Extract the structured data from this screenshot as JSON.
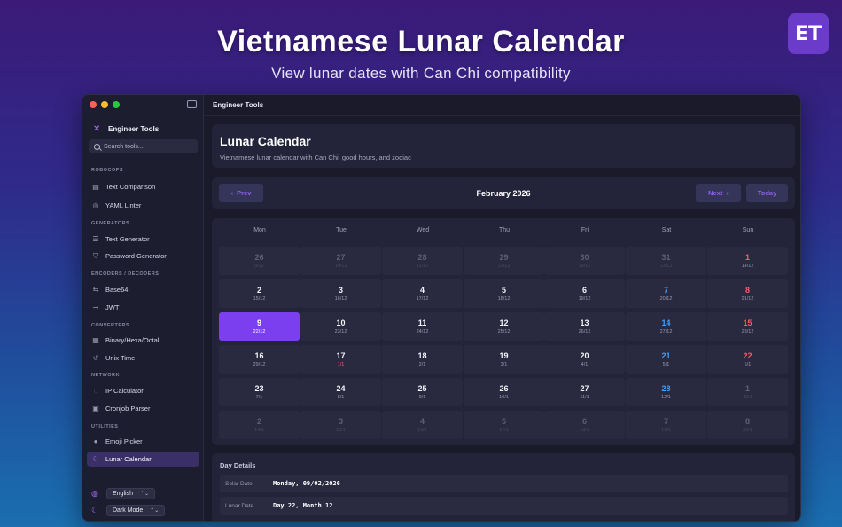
{
  "hero": {
    "title": "Vietnamese Lunar Calendar",
    "subtitle": "View lunar dates with Can Chi compatibility",
    "badge": "ET"
  },
  "sidebar": {
    "app_name": "Engineer Tools",
    "search_placeholder": "Search tools...",
    "sections": [
      {
        "title": "ROBOCOPS",
        "items": [
          {
            "label": "Text Comparison",
            "icon": "compare-icon"
          },
          {
            "label": "YAML Linter",
            "icon": "check-circle-icon"
          }
        ]
      },
      {
        "title": "GENERATORS",
        "items": [
          {
            "label": "Text Generator",
            "icon": "text-lines-icon"
          },
          {
            "label": "Password Generator",
            "icon": "shield-icon"
          }
        ]
      },
      {
        "title": "ENCODERS / DECODERS",
        "items": [
          {
            "label": "Base64",
            "icon": "swap-icon"
          },
          {
            "label": "JWT",
            "icon": "key-icon"
          }
        ]
      },
      {
        "title": "CONVERTERS",
        "items": [
          {
            "label": "Binary/Hexa/Octal",
            "icon": "calculator-icon"
          },
          {
            "label": "Unix Time",
            "icon": "history-icon"
          }
        ]
      },
      {
        "title": "NETWORK",
        "items": [
          {
            "label": "IP Calculator",
            "icon": "network-icon"
          },
          {
            "label": "Cronjob Parser",
            "icon": "calendar-clock-icon"
          }
        ]
      },
      {
        "title": "UTILITIES",
        "items": [
          {
            "label": "Emoji Picker",
            "icon": "emoji-icon"
          },
          {
            "label": "Lunar Calendar",
            "icon": "moon-icon",
            "active": true
          }
        ]
      }
    ],
    "language": "English",
    "theme": "Dark Mode"
  },
  "main": {
    "window_title": "Engineer Tools",
    "page_title": "Lunar Calendar",
    "page_subtitle": "Vietnamese lunar calendar with Can Chi, good hours, and zodiac",
    "prev_label": "Prev",
    "next_label": "Next",
    "today_label": "Today",
    "month_label": "February 2026",
    "weekdays": [
      "Mon",
      "Tue",
      "Wed",
      "Thu",
      "Fri",
      "Sat",
      "Sun"
    ],
    "weeks": [
      [
        {
          "d": "26",
          "l": "9/12",
          "o": true
        },
        {
          "d": "27",
          "l": "10/12",
          "o": true
        },
        {
          "d": "28",
          "l": "11/12",
          "o": true
        },
        {
          "d": "29",
          "l": "12/12",
          "o": true
        },
        {
          "d": "30",
          "l": "13/12",
          "o": true
        },
        {
          "d": "31",
          "l": "13/12",
          "o": true
        },
        {
          "d": "1",
          "l": "14/12"
        }
      ],
      [
        {
          "d": "2",
          "l": "15/12"
        },
        {
          "d": "3",
          "l": "16/12"
        },
        {
          "d": "4",
          "l": "17/12"
        },
        {
          "d": "5",
          "l": "18/12"
        },
        {
          "d": "6",
          "l": "19/12"
        },
        {
          "d": "7",
          "l": "20/12"
        },
        {
          "d": "8",
          "l": "21/12"
        }
      ],
      [
        {
          "d": "9",
          "l": "22/12",
          "t": true
        },
        {
          "d": "10",
          "l": "23/12"
        },
        {
          "d": "11",
          "l": "24/12"
        },
        {
          "d": "12",
          "l": "25/12"
        },
        {
          "d": "13",
          "l": "26/12"
        },
        {
          "d": "14",
          "l": "27/12"
        },
        {
          "d": "15",
          "l": "28/12"
        }
      ],
      [
        {
          "d": "16",
          "l": "29/12"
        },
        {
          "d": "17",
          "l": "1/1",
          "r": true
        },
        {
          "d": "18",
          "l": "2/1"
        },
        {
          "d": "19",
          "l": "3/1"
        },
        {
          "d": "20",
          "l": "4/1"
        },
        {
          "d": "21",
          "l": "5/1"
        },
        {
          "d": "22",
          "l": "6/1"
        }
      ],
      [
        {
          "d": "23",
          "l": "7/1"
        },
        {
          "d": "24",
          "l": "8/1"
        },
        {
          "d": "25",
          "l": "9/1"
        },
        {
          "d": "26",
          "l": "10/1"
        },
        {
          "d": "27",
          "l": "11/1"
        },
        {
          "d": "28",
          "l": "12/1"
        },
        {
          "d": "1",
          "l": "13/1",
          "o": true
        }
      ],
      [
        {
          "d": "2",
          "l": "14/1",
          "o": true
        },
        {
          "d": "3",
          "l": "15/1",
          "o": true
        },
        {
          "d": "4",
          "l": "16/1",
          "o": true
        },
        {
          "d": "5",
          "l": "17/1",
          "o": true
        },
        {
          "d": "6",
          "l": "18/1",
          "o": true
        },
        {
          "d": "7",
          "l": "19/1",
          "o": true
        },
        {
          "d": "8",
          "l": "20/1",
          "o": true
        }
      ]
    ],
    "details_title": "Day Details",
    "details": [
      {
        "label": "Solar Date",
        "value": "Monday, 09/02/2026"
      },
      {
        "label": "Lunar Date",
        "value": "Day 22, Month 12"
      }
    ]
  },
  "colors": {
    "accent": "#7b3ff0",
    "saturday": "#3f9fff",
    "sunday": "#ff5a66"
  }
}
